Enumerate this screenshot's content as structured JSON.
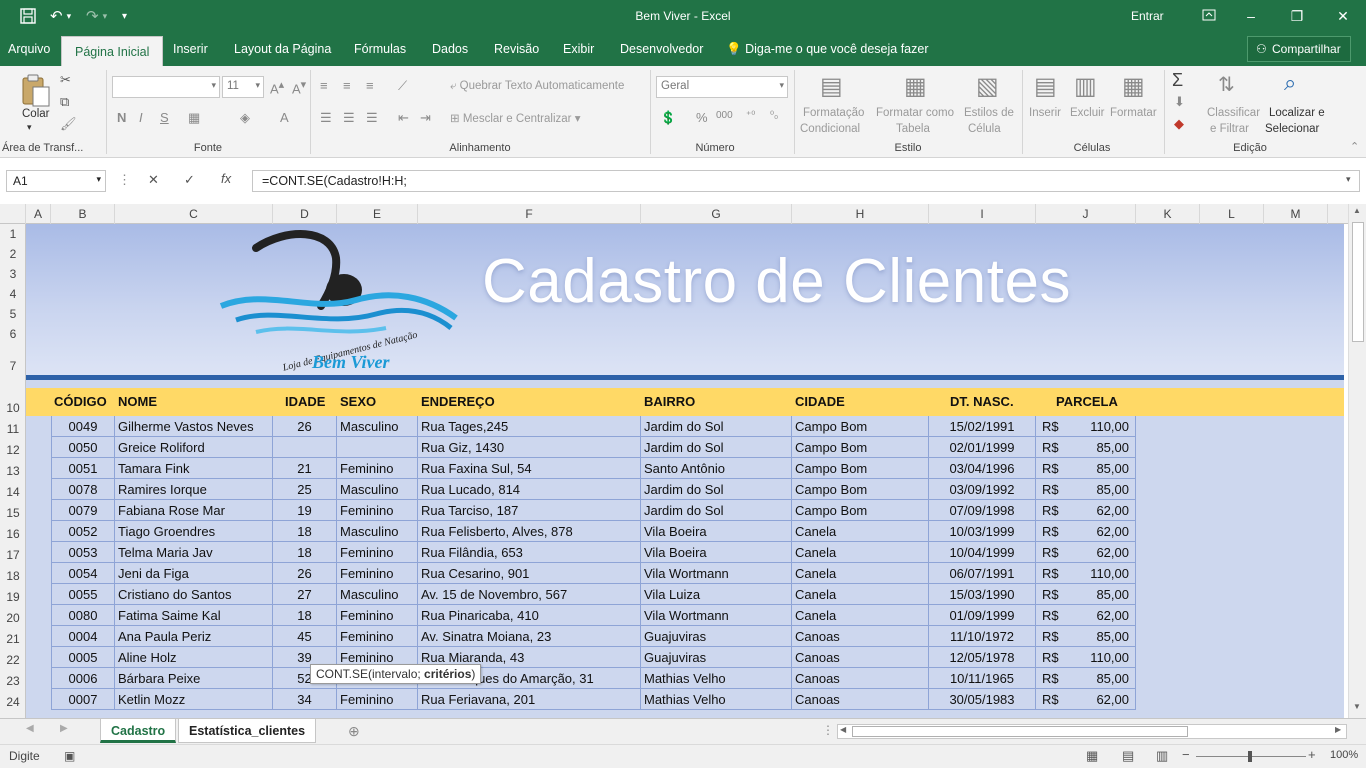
{
  "window": {
    "title": "Bem Viver  -  Excel",
    "signin": "Entrar",
    "minimize": "–",
    "restore": "❐",
    "close": "✕"
  },
  "tabs": [
    {
      "label": "Arquivo"
    },
    {
      "label": "Página Inicial"
    },
    {
      "label": "Inserir"
    },
    {
      "label": "Layout da Página"
    },
    {
      "label": "Fórmulas"
    },
    {
      "label": "Dados"
    },
    {
      "label": "Revisão"
    },
    {
      "label": "Exibir"
    },
    {
      "label": "Desenvolvedor"
    }
  ],
  "tell_me": "Diga-me o que você deseja fazer",
  "share": "Compartilhar",
  "ribbon": {
    "paste": "Colar",
    "font_size": "11",
    "wrap_text": "Quebrar Texto Automaticamente",
    "merge_center": "Mesclar e Centralizar",
    "number_format": "Geral",
    "cond_format_1": "Formatação",
    "cond_format_2": "Condicional",
    "format_table_1": "Formatar como",
    "format_table_2": "Tabela",
    "cell_styles_1": "Estilos de",
    "cell_styles_2": "Célula",
    "insert": "Inserir",
    "delete": "Excluir",
    "format": "Formatar",
    "sort_filter_1": "Classificar",
    "sort_filter_2": "e Filtrar",
    "find_select_1": "Localizar e",
    "find_select_2": "Selecionar",
    "groups": {
      "clipboard": "Área de Transf...",
      "font": "Fonte",
      "alignment": "Alinhamento",
      "number": "Número",
      "styles": "Estilo",
      "cells": "Células",
      "editing": "Edição"
    }
  },
  "namebox": "A1",
  "formula": "=CONT.SE(Cadastro!H:H;",
  "columns": [
    "A",
    "B",
    "C",
    "D",
    "E",
    "F",
    "G",
    "H",
    "I",
    "J",
    "K",
    "L",
    "M"
  ],
  "row_numbers": [
    "1",
    "2",
    "3",
    "4",
    "5",
    "6",
    "7",
    "10",
    "11",
    "12",
    "13",
    "14",
    "15",
    "16",
    "17",
    "18",
    "19",
    "20",
    "21",
    "22",
    "23",
    "24"
  ],
  "banner": {
    "title": "Cadastro de Clientes",
    "logo_arc_text": "Loja de Equipamentos de Natação",
    "logo_name": "Bem Viver"
  },
  "table": {
    "headers": [
      "CÓDIGO",
      "NOME",
      "IDADE",
      "SEXO",
      "ENDEREÇO",
      "BAIRRO",
      "CIDADE",
      "DT. NASC.",
      "PARCELA"
    ],
    "currency": "R$",
    "rows": [
      [
        "0049",
        "Gilherme Vastos Neves",
        "26",
        "Masculino",
        "Rua Tages,245",
        "Jardim do Sol",
        "Campo Bom",
        "15/02/1991",
        "110,00"
      ],
      [
        "0050",
        "Greice Roliford",
        "",
        "",
        "Rua Giz, 1430",
        "Jardim do Sol",
        "Campo Bom",
        "02/01/1999",
        "85,00"
      ],
      [
        "0051",
        "Tamara Fink",
        "21",
        "Feminino",
        "Rua Faxina Sul, 54",
        "Santo Antônio",
        "Campo Bom",
        "03/04/1996",
        "85,00"
      ],
      [
        "0078",
        "Ramires Iorque",
        "25",
        "Masculino",
        "Rua Lucado, 814",
        "Jardim do Sol",
        "Campo Bom",
        "03/09/1992",
        "85,00"
      ],
      [
        "0079",
        "Fabiana Rose Mar",
        "19",
        "Feminino",
        "Rua Tarciso, 187",
        "Jardim do Sol",
        "Campo Bom",
        "07/09/1998",
        "62,00"
      ],
      [
        "0052",
        "Tiago Groendres",
        "18",
        "Masculino",
        "Rua Felisberto, Alves, 878",
        "Vila Boeira",
        "Canela",
        "10/03/1999",
        "62,00"
      ],
      [
        "0053",
        "Telma Maria Jav",
        "18",
        "Feminino",
        "Rua Filândia, 653",
        "Vila Boeira",
        "Canela",
        "10/04/1999",
        "62,00"
      ],
      [
        "0054",
        "Jeni da Figa",
        "26",
        "Feminino",
        "Rua Cesarino, 901",
        "Vila Wortmann",
        "Canela",
        "06/07/1991",
        "110,00"
      ],
      [
        "0055",
        "Cristiano do Santos",
        "27",
        "Masculino",
        "Av. 15 de Novembro, 567",
        "Vila Luiza",
        "Canela",
        "15/03/1990",
        "85,00"
      ],
      [
        "0080",
        "Fatima Saime Kal",
        "18",
        "Feminino",
        "Rua Pinaricaba, 410",
        "Vila Wortmann",
        "Canela",
        "01/09/1999",
        "62,00"
      ],
      [
        "0004",
        "Ana Paula Periz",
        "45",
        "Feminino",
        "Av. Sinatra Moiana, 23",
        "Guajuviras",
        "Canoas",
        "11/10/1972",
        "85,00"
      ],
      [
        "0005",
        "Aline Holz",
        "39",
        "Feminino",
        "Rua Miaranda, 43",
        "Guajuviras",
        "Canoas",
        "12/05/1978",
        "110,00"
      ],
      [
        "0006",
        "Bárbara Peixe",
        "52",
        "Feminino",
        "Rua Marques do Amarção, 31",
        "Mathias Velho",
        "Canoas",
        "10/11/1965",
        "85,00"
      ],
      [
        "0007",
        "Ketlin Mozz",
        "34",
        "Feminino",
        "Rua Feriavana, 201",
        "Mathias Velho",
        "Canoas",
        "30/05/1983",
        "62,00"
      ]
    ]
  },
  "tooltip": {
    "func": "CONT.SE(intervalo; ",
    "arg": "critérios",
    "end": ")"
  },
  "sheets": [
    {
      "label": "Cadastro",
      "active": true
    },
    {
      "label": "Estatística_clientes",
      "active": false
    }
  ],
  "status": {
    "mode": "Digite",
    "zoom": "100%"
  },
  "colors": {
    "excel_green": "#217346",
    "header_yellow": "#ffd966",
    "banner_blue": "#2e62a8"
  }
}
